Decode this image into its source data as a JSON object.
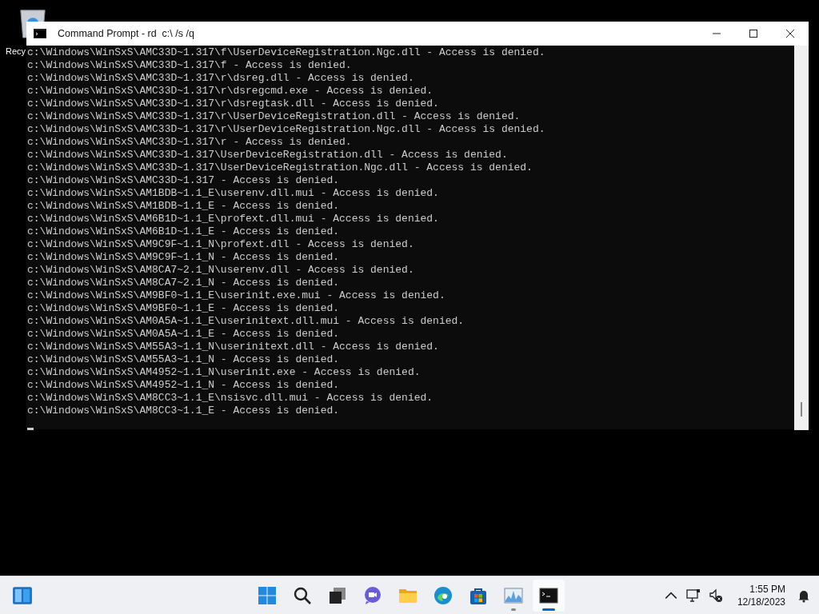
{
  "desktop": {
    "icons": [
      {
        "label": "Recy"
      }
    ]
  },
  "window": {
    "title": "Command Prompt - rd  c:\\ /s /q",
    "lines": [
      "c:\\Windows\\WinSxS\\AMC33D~1.317\\f\\UserDeviceRegistration.Ngc.dll - Access is denied.",
      "c:\\Windows\\WinSxS\\AMC33D~1.317\\f - Access is denied.",
      "c:\\Windows\\WinSxS\\AMC33D~1.317\\r\\dsreg.dll - Access is denied.",
      "c:\\Windows\\WinSxS\\AMC33D~1.317\\r\\dsregcmd.exe - Access is denied.",
      "c:\\Windows\\WinSxS\\AMC33D~1.317\\r\\dsregtask.dll - Access is denied.",
      "c:\\Windows\\WinSxS\\AMC33D~1.317\\r\\UserDeviceRegistration.dll - Access is denied.",
      "c:\\Windows\\WinSxS\\AMC33D~1.317\\r\\UserDeviceRegistration.Ngc.dll - Access is denied.",
      "c:\\Windows\\WinSxS\\AMC33D~1.317\\r - Access is denied.",
      "c:\\Windows\\WinSxS\\AMC33D~1.317\\UserDeviceRegistration.dll - Access is denied.",
      "c:\\Windows\\WinSxS\\AMC33D~1.317\\UserDeviceRegistration.Ngc.dll - Access is denied.",
      "c:\\Windows\\WinSxS\\AMC33D~1.317 - Access is denied.",
      "c:\\Windows\\WinSxS\\AM1BDB~1.1_E\\userenv.dll.mui - Access is denied.",
      "c:\\Windows\\WinSxS\\AM1BDB~1.1_E - Access is denied.",
      "c:\\Windows\\WinSxS\\AM6B1D~1.1_E\\profext.dll.mui - Access is denied.",
      "c:\\Windows\\WinSxS\\AM6B1D~1.1_E - Access is denied.",
      "c:\\Windows\\WinSxS\\AM9C9F~1.1_N\\profext.dll - Access is denied.",
      "c:\\Windows\\WinSxS\\AM9C9F~1.1_N - Access is denied.",
      "c:\\Windows\\WinSxS\\AM8CA7~2.1_N\\userenv.dll - Access is denied.",
      "c:\\Windows\\WinSxS\\AM8CA7~2.1_N - Access is denied.",
      "c:\\Windows\\WinSxS\\AM9BF0~1.1_E\\userinit.exe.mui - Access is denied.",
      "c:\\Windows\\WinSxS\\AM9BF0~1.1_E - Access is denied.",
      "c:\\Windows\\WinSxS\\AM0A5A~1.1_E\\userinitext.dll.mui - Access is denied.",
      "c:\\Windows\\WinSxS\\AM0A5A~1.1_E - Access is denied.",
      "c:\\Windows\\WinSxS\\AM55A3~1.1_N\\userinitext.dll - Access is denied.",
      "c:\\Windows\\WinSxS\\AM55A3~1.1_N - Access is denied.",
      "c:\\Windows\\WinSxS\\AM4952~1.1_N\\userinit.exe - Access is denied.",
      "c:\\Windows\\WinSxS\\AM4952~1.1_N - Access is denied.",
      "c:\\Windows\\WinSxS\\AM8CC3~1.1_E\\nsisvc.dll.mui - Access is denied.",
      "c:\\Windows\\WinSxS\\AM8CC3~1.1_E - Access is denied."
    ]
  },
  "taskbar": {
    "apps": [
      {
        "kind": "start",
        "running": false,
        "selected": false
      },
      {
        "kind": "search",
        "running": false,
        "selected": false
      },
      {
        "kind": "taskview",
        "running": false,
        "selected": false
      },
      {
        "kind": "chat",
        "running": false,
        "selected": false
      },
      {
        "kind": "explorer",
        "running": false,
        "selected": false
      },
      {
        "kind": "edge",
        "running": false,
        "selected": false
      },
      {
        "kind": "store",
        "running": false,
        "selected": false
      },
      {
        "kind": "taskmgr",
        "running": true,
        "selected": false
      },
      {
        "kind": "terminal",
        "running": true,
        "selected": true
      }
    ],
    "clock": {
      "time": "1:55 PM",
      "date": "12/18/2023"
    }
  }
}
